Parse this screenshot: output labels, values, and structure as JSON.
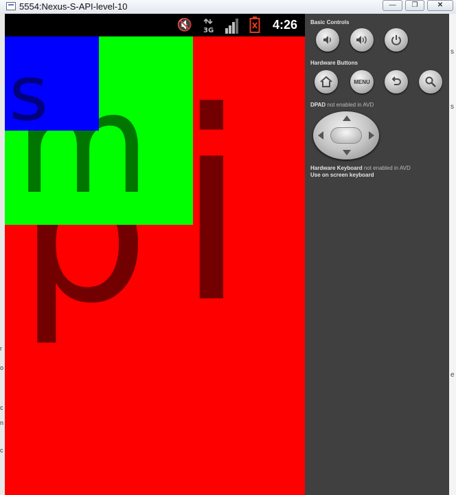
{
  "window": {
    "title": "5554:Nexus-S-API-level-10",
    "minimize_icon": "minimize-icon",
    "restore_icon": "restore-icon",
    "close_icon": "close-icon"
  },
  "status_bar": {
    "time": "4:26",
    "icons": [
      "mute-icon",
      "3g-data-icon",
      "signal-strength-icon",
      "battery-alert-icon"
    ],
    "battery_color": "#e53a1d"
  },
  "screen": {
    "layers": [
      {
        "name": "large",
        "letter": "p",
        "background": "#ff0000",
        "text_color": "#720000"
      },
      {
        "name": "large-i",
        "letter": "i",
        "text_color": "#720000"
      },
      {
        "name": "medium",
        "letter": "m",
        "background": "#00ff00",
        "text_color": "#007600"
      },
      {
        "name": "small",
        "letter": "s",
        "background": "#0000ff",
        "text_color": "#000080"
      }
    ]
  },
  "panel": {
    "basic_controls_label": "Basic Controls",
    "basic_controls": [
      "volume-down-icon",
      "volume-up-icon",
      "power-icon"
    ],
    "hardware_buttons_label": "Hardware Buttons",
    "hardware_buttons": [
      "home-icon",
      "menu-button",
      "back-icon",
      "search-icon"
    ],
    "menu_label": "MENU",
    "dpad_label": "DPAD",
    "dpad_note": "not enabled in AVD",
    "keyboard_label": "Hardware Keyboard",
    "keyboard_note": "not enabled in AVD",
    "keyboard_line2": "Use on screen keyboard"
  }
}
